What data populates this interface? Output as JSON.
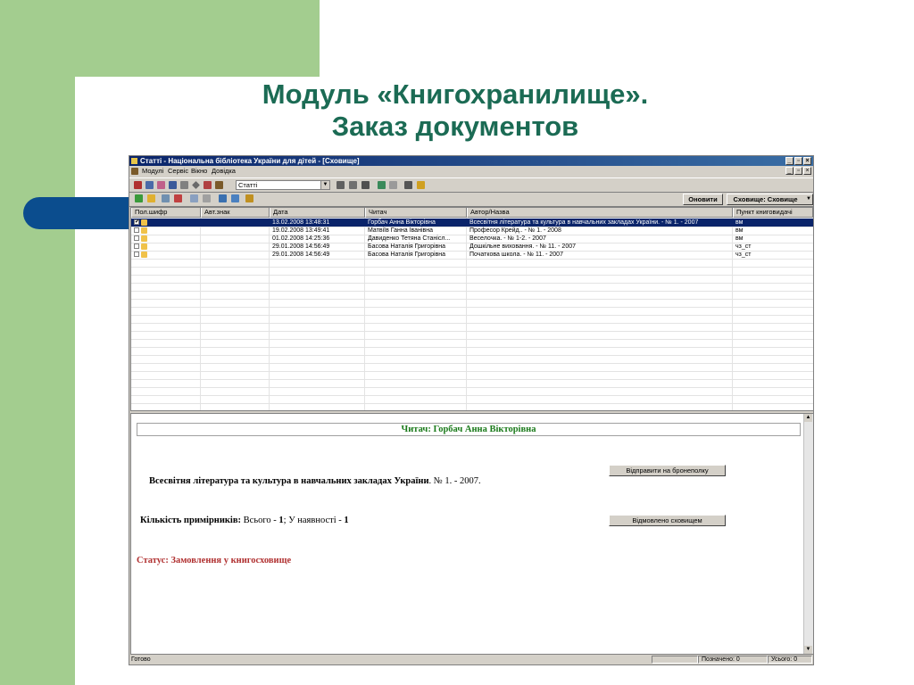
{
  "slide": {
    "title_line1": "Модуль «Книгохранилище».",
    "title_line2": "Заказ документов"
  },
  "window": {
    "title": "Статті - Національна бібліотека України для дітей - [Сховище]",
    "menu": [
      "Модулі",
      "Сервіс",
      "Вікно",
      "Довідка"
    ]
  },
  "toolbar": {
    "combo_value": "Статті",
    "refresh_label": "Оновити",
    "storage_label": "Сховище: Сховище"
  },
  "grid": {
    "columns": [
      "Пол.шифр",
      "Авт.знак",
      "Дата",
      "Читач",
      "Автор/Назва",
      "Пункт книговидачі"
    ],
    "rows": [
      {
        "checked": "✔",
        "date": "13.02.2008  13:48:31",
        "reader": "Горбач Анна Вікторівна",
        "title": "Всесвітня література та культура в навчальних закладах України. - № 1. - 2007",
        "point": "вм"
      },
      {
        "checked": "",
        "date": "19.02.2008  13:49:41",
        "reader": "Матвіїв Ганна Іванівна",
        "title": "Професор Крейд.. - № 1. - 2008",
        "point": "вм"
      },
      {
        "checked": "",
        "date": "01.02.2008  14:25:36",
        "reader": "Давиденко Тетяна Станісл...",
        "title": "Веселочка. - № 1-2. - 2007",
        "point": "вм"
      },
      {
        "checked": "",
        "date": "29.01.2008  14:56:49",
        "reader": "Басова Наталія Григорівна",
        "title": "Дошкільне виховання. - № 11. - 2007",
        "point": "чз_ст"
      },
      {
        "checked": "",
        "date": "29.01.2008  14:56:49",
        "reader": "Басова Наталія Григорівна",
        "title": "Початкова школа. - № 11. - 2007",
        "point": "чз_ст"
      }
    ]
  },
  "detail": {
    "reader": "Читач: Горбач Анна Вікторівна",
    "doc_title_bold": "Всесвітня література та культура в навчальних закладах України",
    "doc_title_rest": ". № 1. - 2007.",
    "copies_label": "Кількість примірників:",
    "copies_total_label": " Всього - ",
    "copies_total": "1",
    "copies_avail_label": "; У наявності - ",
    "copies_avail": "1",
    "status": "Статус: Замовлення у книгосховище",
    "send_button": "Відправити на бронеполку",
    "reject_button": "Відмовлено сховищем"
  },
  "statusbar": {
    "ready": "Готово",
    "marked": "Позначено: 0",
    "total": "Усього: 0"
  },
  "colors": {
    "slide_green": "#a3cd8f",
    "title_text": "#1b6b54",
    "blue_tab": "#0b4d8e",
    "selection": "#0a246a",
    "reader_text": "#1a7a1a",
    "status_text": "#b03030"
  }
}
